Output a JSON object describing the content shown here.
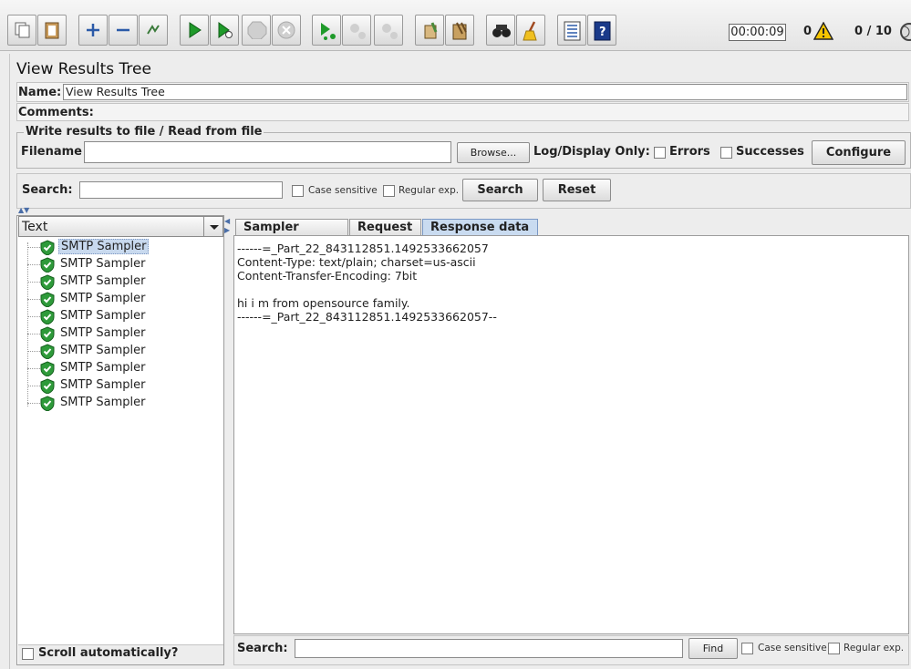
{
  "toolbar": {
    "icons": [
      "copy-icon",
      "paste-icon",
      "expand-icon",
      "collapse-icon",
      "toggle-icon",
      "start-icon",
      "start-no-pause-icon",
      "stop-icon",
      "shutdown-icon",
      "remote-start-icon",
      "remote-stop-icon",
      "remote-shutdown-icon",
      "clear-icon",
      "clear-all-icon",
      "search-binoculars-icon",
      "reset-search-broom-icon",
      "function-helper-icon",
      "help-icon"
    ],
    "timer": "00:00:09",
    "warnings": "0",
    "threads": "0 / 10"
  },
  "panel": {
    "title": "View Results Tree",
    "name_label": "Name:",
    "name_value": "View Results Tree",
    "comments_label": "Comments:"
  },
  "file": {
    "group_title": "Write results to file / Read from file",
    "filename_label": "Filename",
    "browse": "Browse...",
    "log_display": "Log/Display Only:",
    "errors": "Errors",
    "successes": "Successes",
    "configure": "Configure"
  },
  "search": {
    "label": "Search:",
    "case_sensitive": "Case sensitive",
    "regex": "Regular exp.",
    "search_btn": "Search",
    "reset_btn": "Reset"
  },
  "tree": {
    "renderer": "Text",
    "items": [
      "SMTP Sampler",
      "SMTP Sampler",
      "SMTP Sampler",
      "SMTP Sampler",
      "SMTP Sampler",
      "SMTP Sampler",
      "SMTP Sampler",
      "SMTP Sampler",
      "SMTP Sampler",
      "SMTP Sampler"
    ],
    "scroll_auto": "Scroll automatically?"
  },
  "tabs": [
    "Sampler result",
    "Request",
    "Response data"
  ],
  "response": {
    "lines": [
      "------=_Part_22_843112851.1492533662057",
      "Content-Type: text/plain; charset=us-ascii",
      "Content-Transfer-Encoding: 7bit",
      "",
      "hi i m from opensource family.",
      "------=_Part_22_843112851.1492533662057--"
    ]
  },
  "bottom_search": {
    "label": "Search:",
    "find": "Find",
    "case_sensitive": "Case sensitive",
    "regex": "Regular exp."
  },
  "colors": {
    "success": "#2e9a3a",
    "selection": "#c8d9ee"
  }
}
